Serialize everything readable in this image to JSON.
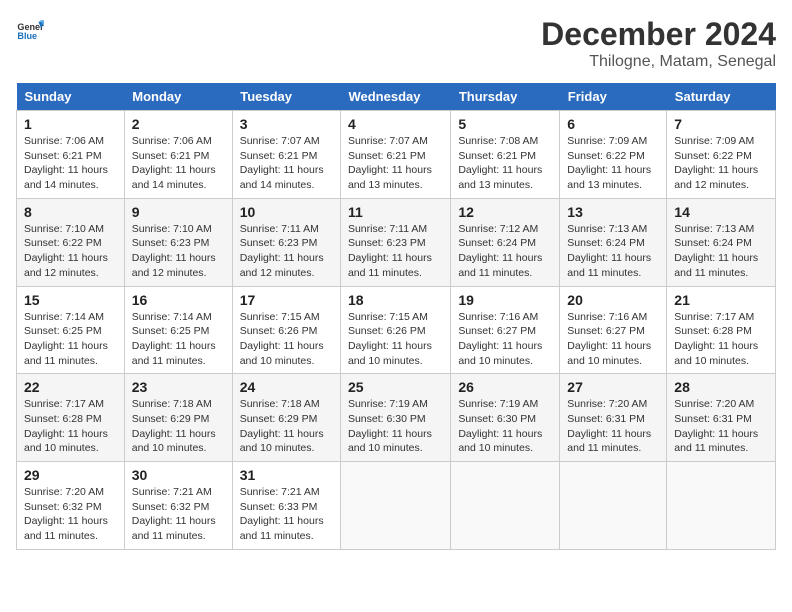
{
  "header": {
    "logo_general": "General",
    "logo_blue": "Blue",
    "month": "December 2024",
    "location": "Thilogne, Matam, Senegal"
  },
  "weekdays": [
    "Sunday",
    "Monday",
    "Tuesday",
    "Wednesday",
    "Thursday",
    "Friday",
    "Saturday"
  ],
  "weeks": [
    [
      {
        "day": "1",
        "sunrise": "7:06 AM",
        "sunset": "6:21 PM",
        "daylight": "11 hours and 14 minutes."
      },
      {
        "day": "2",
        "sunrise": "7:06 AM",
        "sunset": "6:21 PM",
        "daylight": "11 hours and 14 minutes."
      },
      {
        "day": "3",
        "sunrise": "7:07 AM",
        "sunset": "6:21 PM",
        "daylight": "11 hours and 14 minutes."
      },
      {
        "day": "4",
        "sunrise": "7:07 AM",
        "sunset": "6:21 PM",
        "daylight": "11 hours and 13 minutes."
      },
      {
        "day": "5",
        "sunrise": "7:08 AM",
        "sunset": "6:21 PM",
        "daylight": "11 hours and 13 minutes."
      },
      {
        "day": "6",
        "sunrise": "7:09 AM",
        "sunset": "6:22 PM",
        "daylight": "11 hours and 13 minutes."
      },
      {
        "day": "7",
        "sunrise": "7:09 AM",
        "sunset": "6:22 PM",
        "daylight": "11 hours and 12 minutes."
      }
    ],
    [
      {
        "day": "8",
        "sunrise": "7:10 AM",
        "sunset": "6:22 PM",
        "daylight": "11 hours and 12 minutes."
      },
      {
        "day": "9",
        "sunrise": "7:10 AM",
        "sunset": "6:23 PM",
        "daylight": "11 hours and 12 minutes."
      },
      {
        "day": "10",
        "sunrise": "7:11 AM",
        "sunset": "6:23 PM",
        "daylight": "11 hours and 12 minutes."
      },
      {
        "day": "11",
        "sunrise": "7:11 AM",
        "sunset": "6:23 PM",
        "daylight": "11 hours and 11 minutes."
      },
      {
        "day": "12",
        "sunrise": "7:12 AM",
        "sunset": "6:24 PM",
        "daylight": "11 hours and 11 minutes."
      },
      {
        "day": "13",
        "sunrise": "7:13 AM",
        "sunset": "6:24 PM",
        "daylight": "11 hours and 11 minutes."
      },
      {
        "day": "14",
        "sunrise": "7:13 AM",
        "sunset": "6:24 PM",
        "daylight": "11 hours and 11 minutes."
      }
    ],
    [
      {
        "day": "15",
        "sunrise": "7:14 AM",
        "sunset": "6:25 PM",
        "daylight": "11 hours and 11 minutes."
      },
      {
        "day": "16",
        "sunrise": "7:14 AM",
        "sunset": "6:25 PM",
        "daylight": "11 hours and 11 minutes."
      },
      {
        "day": "17",
        "sunrise": "7:15 AM",
        "sunset": "6:26 PM",
        "daylight": "11 hours and 10 minutes."
      },
      {
        "day": "18",
        "sunrise": "7:15 AM",
        "sunset": "6:26 PM",
        "daylight": "11 hours and 10 minutes."
      },
      {
        "day": "19",
        "sunrise": "7:16 AM",
        "sunset": "6:27 PM",
        "daylight": "11 hours and 10 minutes."
      },
      {
        "day": "20",
        "sunrise": "7:16 AM",
        "sunset": "6:27 PM",
        "daylight": "11 hours and 10 minutes."
      },
      {
        "day": "21",
        "sunrise": "7:17 AM",
        "sunset": "6:28 PM",
        "daylight": "11 hours and 10 minutes."
      }
    ],
    [
      {
        "day": "22",
        "sunrise": "7:17 AM",
        "sunset": "6:28 PM",
        "daylight": "11 hours and 10 minutes."
      },
      {
        "day": "23",
        "sunrise": "7:18 AM",
        "sunset": "6:29 PM",
        "daylight": "11 hours and 10 minutes."
      },
      {
        "day": "24",
        "sunrise": "7:18 AM",
        "sunset": "6:29 PM",
        "daylight": "11 hours and 10 minutes."
      },
      {
        "day": "25",
        "sunrise": "7:19 AM",
        "sunset": "6:30 PM",
        "daylight": "11 hours and 10 minutes."
      },
      {
        "day": "26",
        "sunrise": "7:19 AM",
        "sunset": "6:30 PM",
        "daylight": "11 hours and 10 minutes."
      },
      {
        "day": "27",
        "sunrise": "7:20 AM",
        "sunset": "6:31 PM",
        "daylight": "11 hours and 11 minutes."
      },
      {
        "day": "28",
        "sunrise": "7:20 AM",
        "sunset": "6:31 PM",
        "daylight": "11 hours and 11 minutes."
      }
    ],
    [
      {
        "day": "29",
        "sunrise": "7:20 AM",
        "sunset": "6:32 PM",
        "daylight": "11 hours and 11 minutes."
      },
      {
        "day": "30",
        "sunrise": "7:21 AM",
        "sunset": "6:32 PM",
        "daylight": "11 hours and 11 minutes."
      },
      {
        "day": "31",
        "sunrise": "7:21 AM",
        "sunset": "6:33 PM",
        "daylight": "11 hours and 11 minutes."
      },
      null,
      null,
      null,
      null
    ]
  ],
  "labels": {
    "sunrise": "Sunrise: ",
    "sunset": "Sunset: ",
    "daylight": "Daylight: "
  }
}
